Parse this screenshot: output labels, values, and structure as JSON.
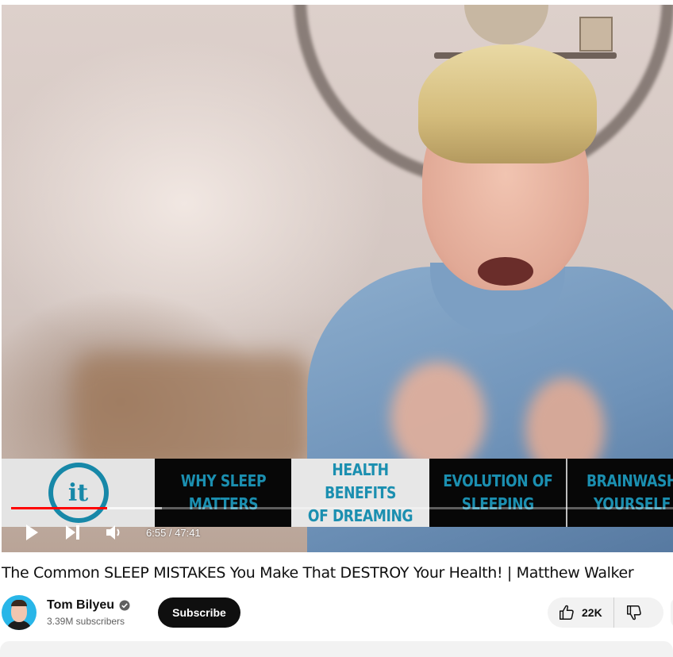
{
  "player": {
    "chapters": [
      {
        "line1": "WHY SLEEP",
        "line2": "MATTERS"
      },
      {
        "line1": "HEALTH BENEFITS",
        "line2": "OF DREAMING"
      },
      {
        "line1": "EVOLUTION OF",
        "line2": "SLEEPING"
      },
      {
        "line1": "BRAINWASH",
        "line2": "YOURSELF"
      }
    ],
    "logo_text": "it",
    "time_display": "6:55 / 47:41",
    "progress_played_fraction": 0.145,
    "progress_buffered_fraction": 0.228,
    "icons": {
      "play": "play-icon",
      "next": "next-icon",
      "volume": "volume-icon"
    }
  },
  "video": {
    "title": "The Common SLEEP MISTAKES You Make That DESTROY Your Health! | Matthew Walker"
  },
  "channel": {
    "name": "Tom Bilyeu",
    "subscribers": "3.39M subscribers",
    "verified_icon": "verified-check-icon"
  },
  "actions": {
    "subscribe_label": "Subscribe",
    "like_count": "22K",
    "like_icon": "thumbs-up-icon",
    "dislike_icon": "thumbs-down-icon"
  },
  "colors": {
    "progress": "#ff0000",
    "subscribe_bg": "#0f0f0f",
    "chapter_accent": "#1b8fb0"
  }
}
